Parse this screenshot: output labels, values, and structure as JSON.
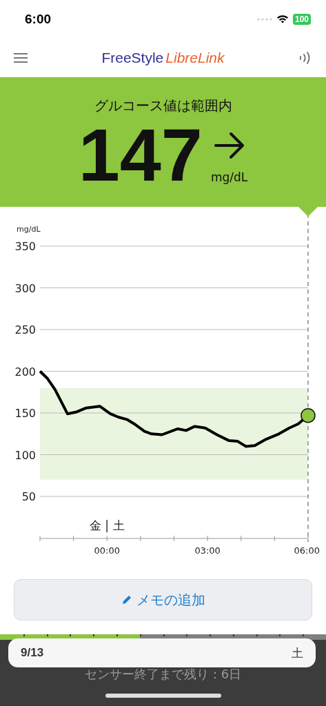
{
  "status_bar": {
    "time": "6:00",
    "battery": "100"
  },
  "header": {
    "logo_primary": "FreeStyle",
    "logo_secondary": "LibreLink"
  },
  "glucose": {
    "status": "グルコース値は範囲内",
    "value": "147",
    "unit": "mg/dL"
  },
  "graph": {
    "day_label": "金 | 土",
    "chart_data": {
      "type": "line",
      "ylabel": "mg/dL",
      "grid": true,
      "bands": [
        {
          "axis": "y",
          "from": 70,
          "to": 180,
          "color": "#eaf5e0"
        }
      ],
      "ylim": [
        50,
        350
      ],
      "yticks": [
        50,
        100,
        150,
        200,
        250,
        300,
        350
      ],
      "xlim": [
        -2,
        6
      ],
      "xticks": [
        {
          "value": 0,
          "label": "00:00"
        },
        {
          "value": 3,
          "label": "03:00"
        },
        {
          "value": 6,
          "label": "06:00"
        }
      ],
      "x": [
        -2,
        -1.79,
        -1.55,
        -1.18,
        -0.93,
        -0.62,
        -0.21,
        0.1,
        0.34,
        0.61,
        0.81,
        1.12,
        1.33,
        1.64,
        2.11,
        2.36,
        2.62,
        2.93,
        3.28,
        3.63,
        3.9,
        4.14,
        4.41,
        4.72,
        5.13,
        5.44,
        5.71,
        6
      ],
      "series": [
        {
          "color": "#000000",
          "values": [
            200,
            192,
            178,
            149,
            151,
            156,
            158,
            149,
            145,
            142,
            137,
            128,
            125,
            124,
            131,
            129,
            134,
            132,
            124,
            117,
            116,
            110,
            111,
            118,
            125,
            132,
            137,
            147
          ]
        }
      ]
    }
  },
  "add_note_button": "メモの追加",
  "sensor": {
    "level": 0.43,
    "date": "9/13",
    "weekday": "土",
    "remaining": "センサー終了まで残り：6日"
  }
}
